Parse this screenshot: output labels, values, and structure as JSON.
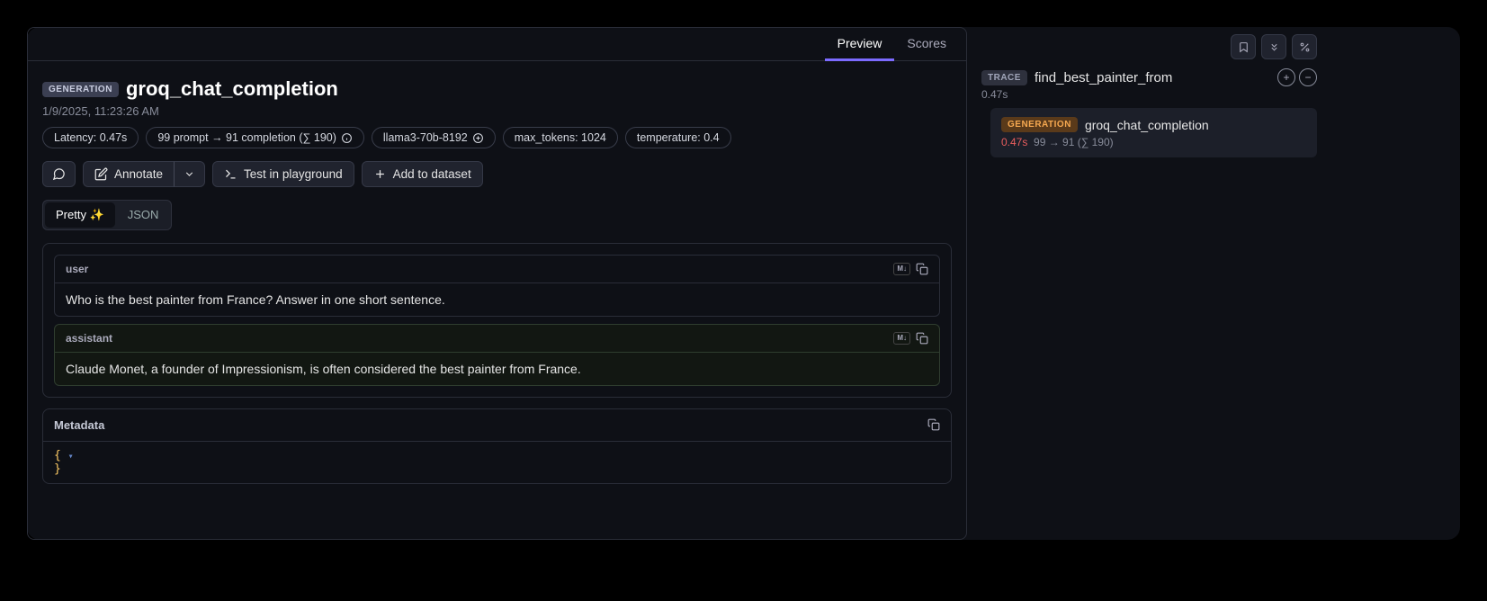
{
  "tabs": {
    "preview": "Preview",
    "scores": "Scores"
  },
  "header": {
    "type_badge": "GENERATION",
    "title": "groq_chat_completion",
    "timestamp": "1/9/2025, 11:23:26 AM"
  },
  "pills": {
    "latency": "Latency: 0.47s",
    "tokens": "99 prompt → 91 completion (∑ 190)",
    "model": "llama3-70b-8192",
    "max_tokens": "max_tokens: 1024",
    "temperature": "temperature: 0.4"
  },
  "actions": {
    "annotate": "Annotate",
    "playground": "Test in playground",
    "dataset": "Add to dataset"
  },
  "view_toggle": {
    "pretty": "Pretty ✨",
    "json": "JSON"
  },
  "messages": {
    "user": {
      "role": "user",
      "content": "Who is the best painter from France? Answer in one short sentence."
    },
    "assistant": {
      "role": "assistant",
      "content": "Claude Monet, a founder of Impressionism, is often considered the best painter from France."
    }
  },
  "metadata": {
    "title": "Metadata",
    "open_brace": "{",
    "close_brace": "}"
  },
  "side": {
    "trace_badge": "TRACE",
    "trace_name": "find_best_painter_from",
    "trace_duration": "0.47s",
    "item": {
      "badge": "GENERATION",
      "name": "groq_chat_completion",
      "latency": "0.47s",
      "tokens": "99 → 91 (∑ 190)"
    }
  },
  "md_label": "M↓"
}
